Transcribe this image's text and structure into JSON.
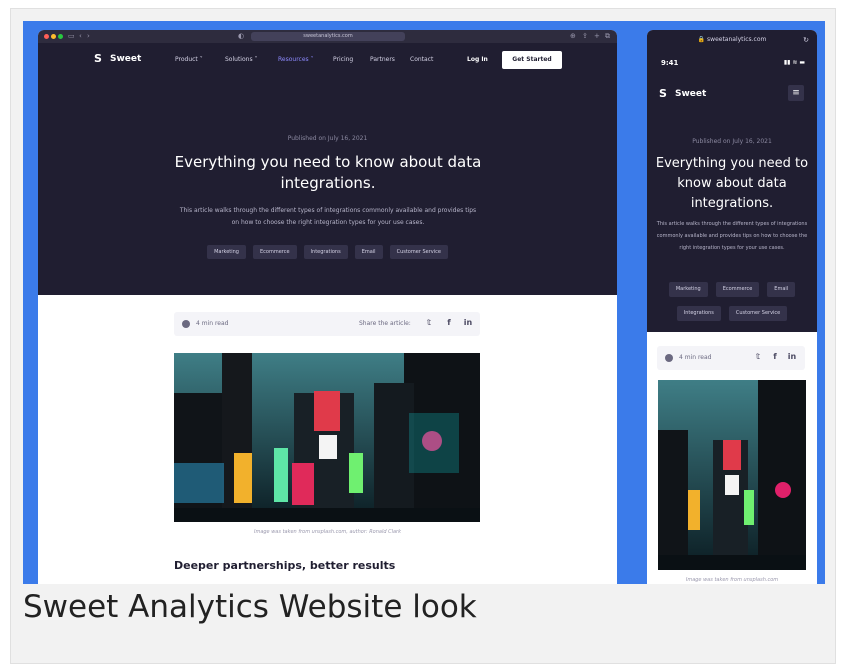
{
  "caption": "Sweet Analytics Website look",
  "colors": {
    "stage_bg": "#3b7bea",
    "hero_bg": "#201e31",
    "accent_nav": "#8d8aff"
  },
  "desktop": {
    "url": "sweetanalytics.com",
    "brand": "Sweet",
    "nav": [
      "Product",
      "Solutions",
      "Resources",
      "Pricing",
      "Partners",
      "Contact"
    ],
    "nav_active": "Resources",
    "login": "Log In",
    "cta": "Get Started",
    "published": "Published on July 16, 2021",
    "title": "Everything you need to know about data integrations.",
    "lead": "This article walks through the different types of integrations commonly available and provides tips on how to choose the right integration types for your use cases.",
    "tags": [
      "Marketing",
      "Ecommerce",
      "Integrations",
      "Email",
      "Customer Service"
    ],
    "read_time": "4 min read",
    "share_label": "Share the article:",
    "image_caption": "Image was taken from unsplash.com, author: Ronald Clark",
    "section_heading": "Deeper partnerships, better results"
  },
  "mobile": {
    "url": "sweetanalytics.com",
    "time": "9:41",
    "brand": "Sweet",
    "published": "Published on July 16, 2021",
    "title": "Everything you need to know about data integrations.",
    "lead": "This article walks through the different types of integrations commonly available and provides tips on how to choose the right integration types for your use cases.",
    "tags": [
      "Marketing",
      "Ecommerce",
      "Email",
      "Integrations",
      "Customer Service"
    ],
    "read_time": "4 min read",
    "image_caption": "Image was taken from unsplash.com"
  }
}
